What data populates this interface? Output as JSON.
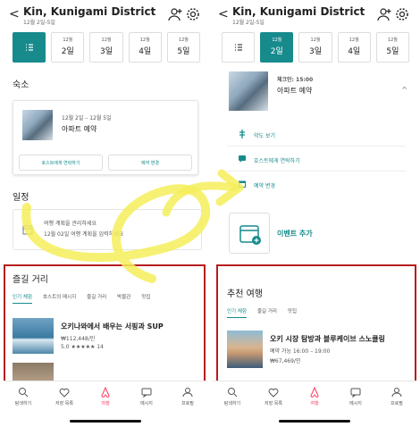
{
  "header": {
    "title": "Kin, Kunigami District",
    "dates": "12월 2일-5일"
  },
  "days": [
    {
      "month": "12월",
      "day": "2일"
    },
    {
      "month": "12월",
      "day": "3일"
    },
    {
      "month": "12월",
      "day": "4일"
    },
    {
      "month": "12월",
      "day": "5일"
    }
  ],
  "left": {
    "lodging_title": "숙소",
    "lodging_dates": "12월 2일 – 12월 5일",
    "lodging_name": "아파트 예약",
    "btn_contact": "호스트에게 연락하기",
    "btn_change": "예약 변경",
    "schedule_title": "일정",
    "plan_line1": "여행 계획을 관리하세요",
    "plan_line2": "12월 02일 여행 계획을 입력하세요",
    "fun_title": "즐길 거리",
    "tabs": [
      "인기 체험",
      "호스트의 메시지",
      "즐길 거리",
      "박물관",
      "맛집"
    ],
    "exp_title": "오키나와에서 배우는 서핑과 SUP",
    "exp_price": "₩112,448/인",
    "exp_rating": "5.0 ★★★★★ 14"
  },
  "right": {
    "checkin": "체크인: 15:00",
    "lodging_name": "아파트 예약",
    "actions": [
      "약도 보기",
      "호스트에게 연락하기",
      "예약 변경"
    ],
    "add_event": "이벤트 추가",
    "rec_title": "추천 여행",
    "tabs": [
      "인기 체험",
      "즐길 거리",
      "맛집"
    ],
    "exp_title": "오키 시장 탐방과 블루케이브 스노클링",
    "exp_time": "예약 가능 16:00 – 19:00",
    "exp_price": "₩67,469/인"
  },
  "nav": [
    "탐색하기",
    "저장 목록",
    "여행",
    "메시지",
    "프로필"
  ],
  "colors": {
    "accent": "#178a8c",
    "nav_active": "#ff385c",
    "highlight": "#b51d1d",
    "arrow": "#f4ef5a"
  },
  "icons": [
    "back-icon",
    "add-user-icon",
    "gear-icon",
    "list-icon",
    "calendar-icon",
    "map-icon",
    "chat-icon",
    "search-icon",
    "heart-icon",
    "airbnb-icon",
    "message-icon",
    "profile-icon"
  ]
}
